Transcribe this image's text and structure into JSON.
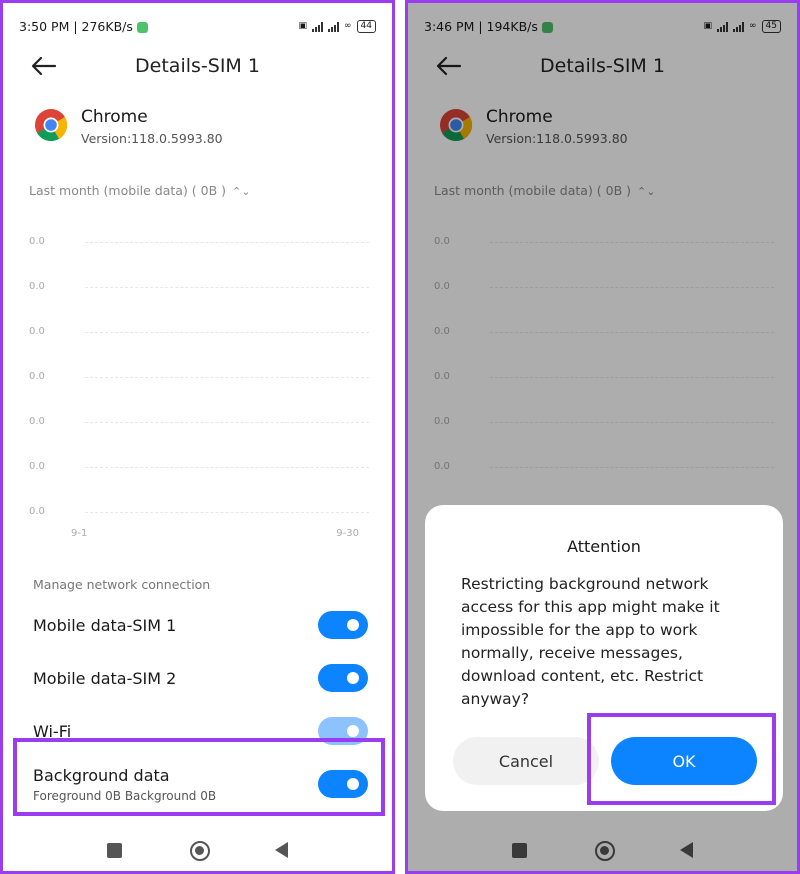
{
  "left": {
    "status": {
      "time_speed": "3:50 PM | 276KB/s",
      "battery": "44"
    },
    "page_title": "Details-SIM 1",
    "app": {
      "name": "Chrome",
      "version": "Version:118.0.5993.80"
    },
    "period": "Last month (mobile data) ( 0B )",
    "chart_data": {
      "type": "line",
      "y_ticks": [
        "0.0",
        "0.0",
        "0.0",
        "0.0",
        "0.0",
        "0.0",
        "0.0"
      ],
      "x_ticks": [
        "9-1",
        "9-30"
      ],
      "values": []
    },
    "section_label": "Manage network connection",
    "rows": [
      {
        "label": "Mobile data-SIM 1",
        "on": true
      },
      {
        "label": "Mobile data-SIM 2",
        "on": true
      },
      {
        "label": "Wi-Fi",
        "on": true
      },
      {
        "label": "Background data",
        "sub": "Foreground 0B  Background 0B",
        "on": true
      }
    ]
  },
  "right": {
    "status": {
      "time_speed": "3:46 PM | 194KB/s",
      "battery": "45"
    },
    "page_title": "Details-SIM 1",
    "app": {
      "name": "Chrome",
      "version": "Version:118.0.5993.80"
    },
    "period": "Last month (mobile data) ( 0B )",
    "chart_data": {
      "type": "line",
      "y_ticks": [
        "0.0",
        "0.0",
        "0.0",
        "0.0",
        "0.0",
        "0.0"
      ],
      "values": []
    },
    "dialog": {
      "title": "Attention",
      "message": "Restricting background network access for this app might make it impossible for the app to work normally, receive messages, download content, etc. Restrict anyway?",
      "cancel_label": "Cancel",
      "ok_label": "OK"
    }
  },
  "colors": {
    "accent": "#0d84ff",
    "highlight": "#9a3cf0"
  }
}
